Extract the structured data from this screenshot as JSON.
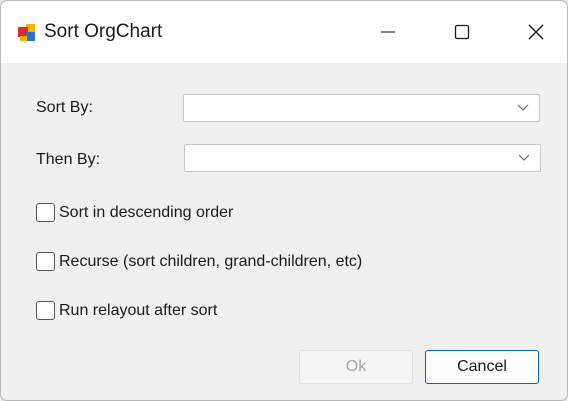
{
  "window": {
    "title": "Sort OrgChart",
    "controls": {
      "minimize": "minimize-icon",
      "maximize": "maximize-icon",
      "close": "close-icon"
    }
  },
  "form": {
    "sort_by": {
      "label": "Sort By:",
      "value": ""
    },
    "then_by": {
      "label": "Then By:",
      "value": ""
    },
    "options": [
      {
        "label": "Sort in descending order",
        "checked": false
      },
      {
        "label": "Recurse (sort children, grand-children, etc)",
        "checked": false
      },
      {
        "label": "Run relayout after sort",
        "checked": false
      }
    ]
  },
  "buttons": {
    "ok": {
      "label": "Ok",
      "enabled": false
    },
    "cancel": {
      "label": "Cancel",
      "enabled": true
    }
  },
  "colors": {
    "accent": "#0b63c5",
    "background": "#f0f0f0",
    "titlebar": "#ffffff"
  }
}
